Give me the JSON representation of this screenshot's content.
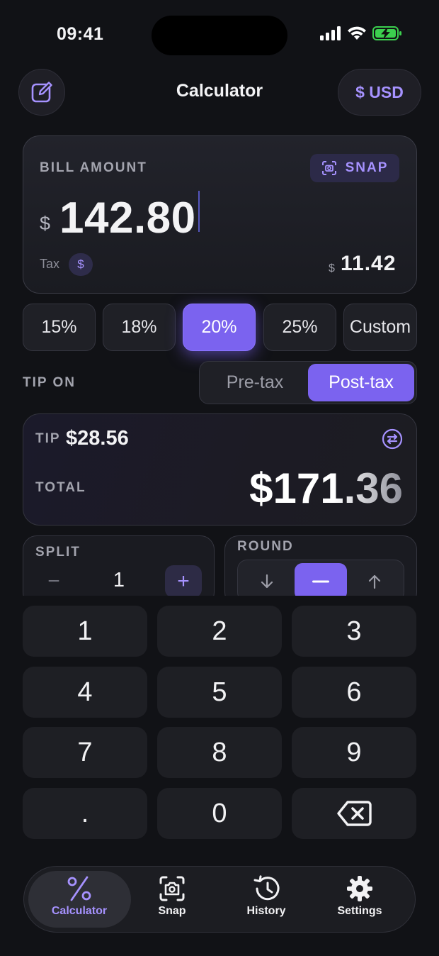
{
  "status": {
    "time": "09:41"
  },
  "header": {
    "title": "Calculator",
    "currency": "$ USD"
  },
  "bill": {
    "label": "BILL AMOUNT",
    "snap_label": "SNAP",
    "currency_symbol": "$",
    "amount": "142.80",
    "tax_label": "Tax",
    "tax_chip": "$",
    "tax_symbol": "$",
    "tax_amount": "11.42"
  },
  "tip_options": [
    {
      "label": "15%",
      "selected": false
    },
    {
      "label": "18%",
      "selected": false
    },
    {
      "label": "20%",
      "selected": true
    },
    {
      "label": "25%",
      "selected": false
    },
    {
      "label": "Custom",
      "selected": false
    }
  ],
  "tip_on": {
    "label": "TIP ON",
    "options": [
      "Pre-tax",
      "Post-tax"
    ],
    "selected": "Post-tax"
  },
  "result": {
    "tip_label": "TIP",
    "tip_amount": "$28.56",
    "total_label": "TOTAL",
    "total_amount": "$171.36"
  },
  "split": {
    "label": "SPLIT",
    "value": "1",
    "minus": "−",
    "plus": "+"
  },
  "round": {
    "label": "ROUND",
    "options": [
      "down",
      "none",
      "up"
    ],
    "selected": "none"
  },
  "keypad": {
    "keys": [
      "1",
      "2",
      "3",
      "4",
      "5",
      "6",
      "7",
      "8",
      "9",
      ".",
      "0",
      "backspace"
    ]
  },
  "tabbar": {
    "tabs": [
      {
        "label": "Calculator",
        "icon": "percent-icon",
        "active": true
      },
      {
        "label": "Snap",
        "icon": "camera-scan-icon",
        "active": false
      },
      {
        "label": "History",
        "icon": "history-icon",
        "active": false
      },
      {
        "label": "Settings",
        "icon": "gear-icon",
        "active": false
      }
    ]
  },
  "colors": {
    "accent": "#7b63ef",
    "accent_text": "#a692ff",
    "background": "#111216",
    "card": "#1e1f24"
  }
}
